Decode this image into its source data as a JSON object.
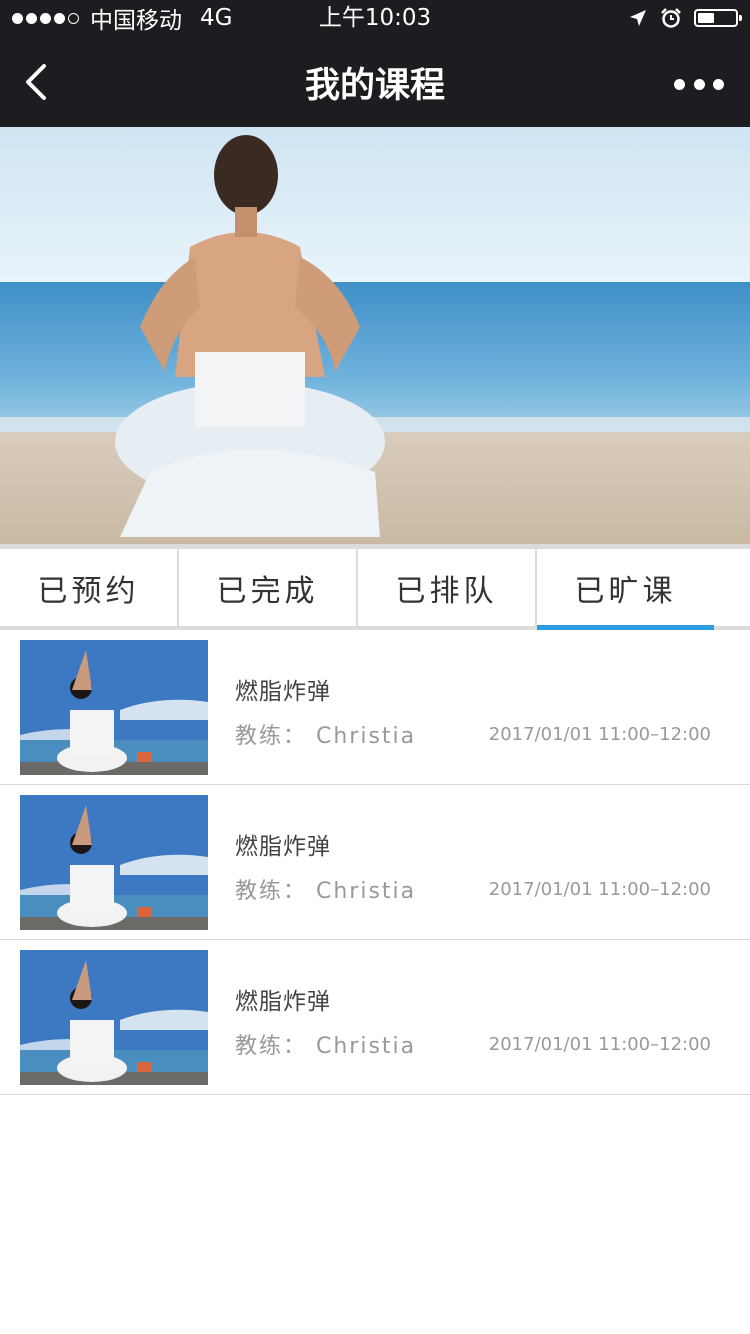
{
  "status_bar": {
    "carrier": "中国移动",
    "network": "4G",
    "time": "上午10:03"
  },
  "nav": {
    "title": "我的课程"
  },
  "tabs": [
    {
      "label": "已预约",
      "active": false
    },
    {
      "label": "已完成",
      "active": false
    },
    {
      "label": "已排队",
      "active": false
    },
    {
      "label": "已旷课",
      "active": true
    }
  ],
  "courses": [
    {
      "title": "燃脂炸弹",
      "coach": "教练： Christia",
      "time": "2017/01/01 11:00–12:00"
    },
    {
      "title": "燃脂炸弹",
      "coach": "教练： Christia",
      "time": "2017/01/01 11:00–12:00"
    },
    {
      "title": "燃脂炸弹",
      "coach": "教练： Christia",
      "time": "2017/01/01 11:00–12:00"
    }
  ],
  "colors": {
    "header_bg": "#1d1c21",
    "tab_active": "#2a9ee0"
  }
}
